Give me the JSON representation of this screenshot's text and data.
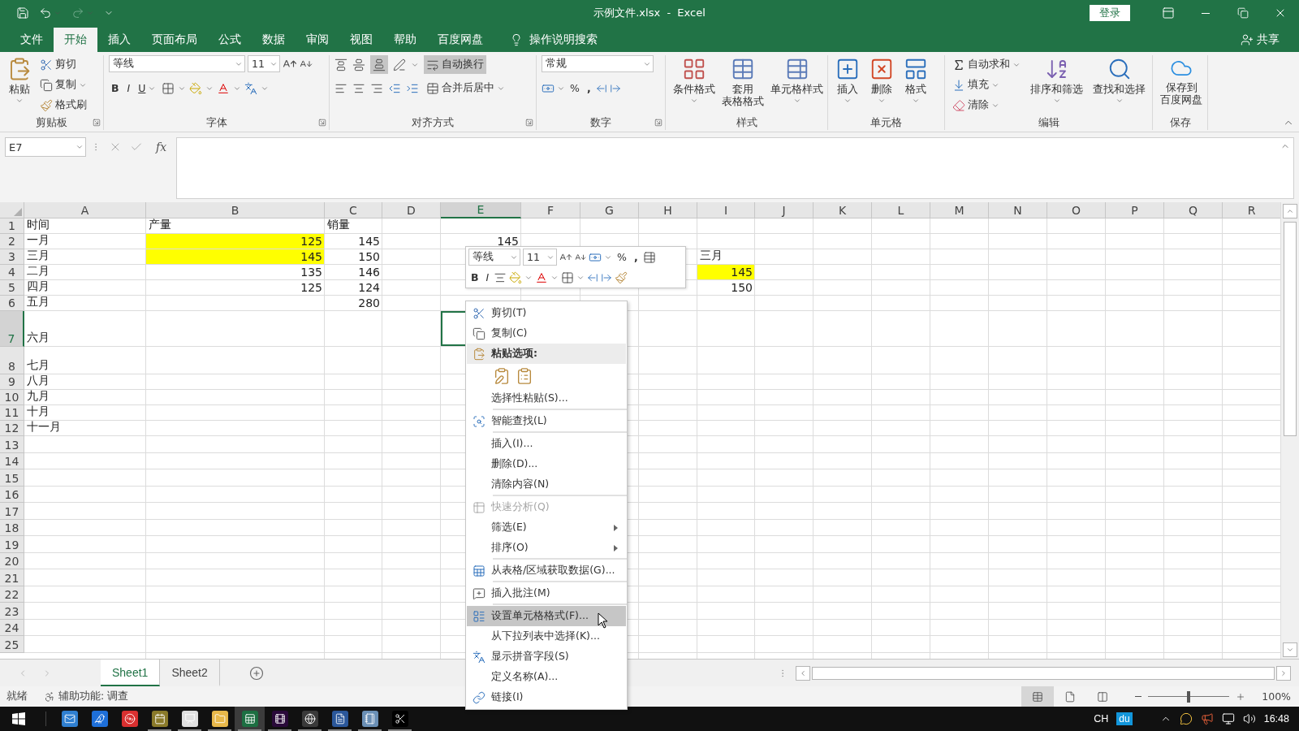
{
  "window": {
    "title": "示例文件.xlsx  -  Excel",
    "sign_in": "登录"
  },
  "menu_tabs": [
    {
      "label": "文件",
      "selected": false
    },
    {
      "label": "开始",
      "selected": true
    },
    {
      "label": "插入",
      "selected": false
    },
    {
      "label": "页面布局",
      "selected": false
    },
    {
      "label": "公式",
      "selected": false
    },
    {
      "label": "数据",
      "selected": false
    },
    {
      "label": "审阅",
      "selected": false
    },
    {
      "label": "视图",
      "selected": false
    },
    {
      "label": "帮助",
      "selected": false
    },
    {
      "label": "百度网盘",
      "selected": false
    }
  ],
  "tell_me": "操作说明搜索",
  "share": "共享",
  "ribbon": {
    "clipboard": {
      "paste": "粘贴",
      "cut": "剪切",
      "copy": "复制",
      "format_painter": "格式刷",
      "label": "剪贴板"
    },
    "font": {
      "font_name": "等线",
      "font_size": "11",
      "bold": "B",
      "italic": "I",
      "underline": "U",
      "label": "字体"
    },
    "alignment": {
      "bottom_align_on": true,
      "wrap_text": "自动换行",
      "wrap_text_on": true,
      "merge": "合并后居中",
      "label": "对齐方式"
    },
    "number": {
      "format": "常规",
      "percent": "%",
      "comma": ",",
      "label": "数字"
    },
    "styles": {
      "conditional": "条件格式",
      "table_format_lines": [
        "套用",
        "表格格式"
      ],
      "cell_styles": "单元格样式",
      "label": "样式"
    },
    "cells": {
      "insert": "插入",
      "delete": "删除",
      "format": "格式",
      "label": "单元格"
    },
    "editing": {
      "autosum": "自动求和",
      "fill": "填充",
      "clear": "清除",
      "sort_filter": "排序和筛选",
      "find_select": "查找和选择",
      "label": "编辑"
    },
    "save": {
      "lines": [
        "保存到",
        "百度网盘"
      ],
      "label": "保存"
    }
  },
  "formula_bar": {
    "name_box": "E7",
    "fx": "fx"
  },
  "sheet": {
    "columns": [
      {
        "label": "A",
        "selected": false
      },
      {
        "label": "B",
        "selected": false
      },
      {
        "label": "C",
        "selected": false
      },
      {
        "label": "D",
        "selected": false
      },
      {
        "label": "E",
        "selected": true
      },
      {
        "label": "F",
        "selected": false
      },
      {
        "label": "G",
        "selected": false
      },
      {
        "label": "H",
        "selected": false
      },
      {
        "label": "I",
        "selected": false
      },
      {
        "label": "J",
        "selected": false
      },
      {
        "label": "K",
        "selected": false
      },
      {
        "label": "L",
        "selected": false
      },
      {
        "label": "M",
        "selected": false
      },
      {
        "label": "N",
        "selected": false
      },
      {
        "label": "O",
        "selected": false
      },
      {
        "label": "P",
        "selected": false
      },
      {
        "label": "Q",
        "selected": false
      },
      {
        "label": "R",
        "selected": false
      }
    ],
    "rows": [
      {
        "label": "1",
        "selected": false,
        "cells": [
          {
            "kind": "text",
            "text": "时间",
            "highlighted": false
          },
          {
            "kind": "text",
            "text": "产量",
            "highlighted": false
          },
          {
            "kind": "text",
            "text": "销量",
            "highlighted": false
          }
        ]
      },
      {
        "label": "2",
        "selected": false,
        "cells": [
          {
            "kind": "text",
            "text": "一月",
            "highlighted": false
          },
          {
            "kind": "number",
            "text": "125",
            "highlighted": true
          },
          {
            "kind": "number",
            "text": "145",
            "highlighted": false
          },
          {
            "kind": "empty"
          },
          {
            "kind": "number",
            "text": "145",
            "highlighted": false
          }
        ]
      },
      {
        "label": "3",
        "selected": false,
        "cells": [
          {
            "kind": "text",
            "text": "三月",
            "highlighted": false
          },
          {
            "kind": "number",
            "text": "145",
            "highlighted": true
          },
          {
            "kind": "number",
            "text": "150",
            "highlighted": false
          },
          {
            "kind": "empty"
          },
          {
            "kind": "empty"
          },
          {
            "kind": "empty"
          },
          {
            "kind": "empty"
          },
          {
            "kind": "empty"
          },
          {
            "kind": "text",
            "text": "三月",
            "highlighted": false
          }
        ]
      },
      {
        "label": "4",
        "selected": false,
        "cells": [
          {
            "kind": "text",
            "text": "二月",
            "highlighted": false
          },
          {
            "kind": "number",
            "text": "135",
            "highlighted": false
          },
          {
            "kind": "number",
            "text": "146",
            "highlighted": false
          },
          {
            "kind": "empty"
          },
          {
            "kind": "empty"
          },
          {
            "kind": "empty"
          },
          {
            "kind": "empty"
          },
          {
            "kind": "empty"
          },
          {
            "kind": "number",
            "text": "145",
            "highlighted": true
          }
        ]
      },
      {
        "label": "5",
        "selected": false,
        "cells": [
          {
            "kind": "text",
            "text": "四月",
            "highlighted": false
          },
          {
            "kind": "number",
            "text": "125",
            "highlighted": false
          },
          {
            "kind": "number",
            "text": "124",
            "highlighted": false
          },
          {
            "kind": "empty"
          },
          {
            "kind": "empty"
          },
          {
            "kind": "empty"
          },
          {
            "kind": "empty"
          },
          {
            "kind": "empty"
          },
          {
            "kind": "number",
            "text": "150",
            "highlighted": false
          }
        ]
      },
      {
        "label": "6",
        "selected": false,
        "cells": [
          {
            "kind": "text",
            "text": "五月",
            "highlighted": false
          },
          {
            "kind": "empty"
          },
          {
            "kind": "number",
            "text": "280",
            "highlighted": false
          }
        ]
      },
      {
        "label": "7",
        "selected": true,
        "cells": [
          {
            "kind": "text",
            "text": "六月",
            "highlighted": false
          }
        ]
      },
      {
        "label": "8",
        "selected": false,
        "cells": [
          {
            "kind": "text",
            "text": "七月",
            "highlighted": false
          }
        ]
      },
      {
        "label": "9",
        "selected": false,
        "cells": [
          {
            "kind": "text",
            "text": "八月",
            "highlighted": false
          }
        ]
      },
      {
        "label": "10",
        "selected": false,
        "cells": [
          {
            "kind": "text",
            "text": "九月",
            "highlighted": false
          }
        ]
      },
      {
        "label": "11",
        "selected": false,
        "cells": [
          {
            "kind": "text",
            "text": "十月",
            "highlighted": false
          }
        ]
      },
      {
        "label": "12",
        "selected": false,
        "cells": [
          {
            "kind": "text",
            "text": "十一月",
            "highlighted": false
          }
        ]
      },
      {
        "label": "13",
        "selected": false
      },
      {
        "label": "14",
        "selected": false
      },
      {
        "label": "15",
        "selected": false
      },
      {
        "label": "16",
        "selected": false
      },
      {
        "label": "17",
        "selected": false
      },
      {
        "label": "18",
        "selected": false
      },
      {
        "label": "19",
        "selected": false
      },
      {
        "label": "20",
        "selected": false
      },
      {
        "label": "21",
        "selected": false
      },
      {
        "label": "22",
        "selected": false
      },
      {
        "label": "23",
        "selected": false
      },
      {
        "label": "24",
        "selected": false
      },
      {
        "label": "25",
        "selected": false
      }
    ]
  },
  "mini_toolbar": {
    "font_name": "等线",
    "font_size": "11",
    "percent": "%",
    "comma": ",",
    "bold": "B",
    "italic": "I"
  },
  "context_menu": {
    "items": [
      {
        "kind": "item",
        "text": "剪切(T)",
        "selected": false,
        "disabled": false,
        "submenu": false
      },
      {
        "kind": "item",
        "text": "复制(C)",
        "selected": false,
        "disabled": false,
        "submenu": false
      },
      {
        "kind": "header",
        "text": "粘贴选项:"
      },
      {
        "kind": "paste_options"
      },
      {
        "kind": "item",
        "text": "选择性粘贴(S)...",
        "selected": false,
        "disabled": false,
        "submenu": false
      },
      {
        "kind": "separator"
      },
      {
        "kind": "item",
        "text": "智能查找(L)",
        "selected": false,
        "disabled": false,
        "submenu": false
      },
      {
        "kind": "separator"
      },
      {
        "kind": "item",
        "text": "插入(I)...",
        "selected": false,
        "disabled": false,
        "submenu": false
      },
      {
        "kind": "item",
        "text": "删除(D)...",
        "selected": false,
        "disabled": false,
        "submenu": false
      },
      {
        "kind": "item",
        "text": "清除内容(N)",
        "selected": false,
        "disabled": false,
        "submenu": false
      },
      {
        "kind": "separator"
      },
      {
        "kind": "item",
        "text": "快速分析(Q)",
        "selected": false,
        "disabled": true,
        "submenu": false
      },
      {
        "kind": "item",
        "text": "筛选(E)",
        "selected": false,
        "disabled": false,
        "submenu": true
      },
      {
        "kind": "item",
        "text": "排序(O)",
        "selected": false,
        "disabled": false,
        "submenu": true
      },
      {
        "kind": "separator"
      },
      {
        "kind": "item",
        "text": "从表格/区域获取数据(G)...",
        "selected": false,
        "disabled": false,
        "submenu": false
      },
      {
        "kind": "separator"
      },
      {
        "kind": "item",
        "text": "插入批注(M)",
        "selected": false,
        "disabled": false,
        "submenu": false
      },
      {
        "kind": "separator"
      },
      {
        "kind": "item",
        "text": "设置单元格格式(F)...",
        "selected": true,
        "disabled": false,
        "submenu": false
      },
      {
        "kind": "item",
        "text": "从下拉列表中选择(K)...",
        "selected": false,
        "disabled": false,
        "submenu": false
      },
      {
        "kind": "item",
        "text": "显示拼音字段(S)",
        "selected": false,
        "disabled": false,
        "submenu": false
      },
      {
        "kind": "item",
        "text": "定义名称(A)...",
        "selected": false,
        "disabled": false,
        "submenu": false
      },
      {
        "kind": "item",
        "text": "链接(I)",
        "selected": false,
        "disabled": false,
        "submenu": false
      }
    ]
  },
  "sheet_tabs": [
    {
      "label": "Sheet1",
      "selected": true
    },
    {
      "label": "Sheet2",
      "selected": false
    }
  ],
  "status_bar": {
    "ready": "就绪",
    "accessibility": "辅助功能: 调查",
    "zoom": "100%",
    "zoom_slider": {
      "level": 0.5
    }
  },
  "taskbar": {
    "apps": [
      {
        "kind": "mail",
        "running": false,
        "active": false
      },
      {
        "kind": "bird",
        "running": false,
        "active": false
      },
      {
        "kind": "music",
        "running": false,
        "active": false
      },
      {
        "kind": "calendar",
        "running": true,
        "active": false
      },
      {
        "kind": "slides",
        "running": true,
        "active": false
      },
      {
        "kind": "folder",
        "running": true,
        "active": false
      },
      {
        "kind": "sheet",
        "running": true,
        "active": true
      },
      {
        "kind": "film",
        "running": true,
        "active": false
      },
      {
        "kind": "globe",
        "running": true,
        "active": false
      },
      {
        "kind": "document",
        "running": true,
        "active": false
      },
      {
        "kind": "notebook",
        "running": true,
        "active": false
      },
      {
        "kind": "scissors",
        "running": true,
        "active": false
      }
    ],
    "input_method": "CH",
    "ime_badge": "du",
    "time": "16:48"
  }
}
